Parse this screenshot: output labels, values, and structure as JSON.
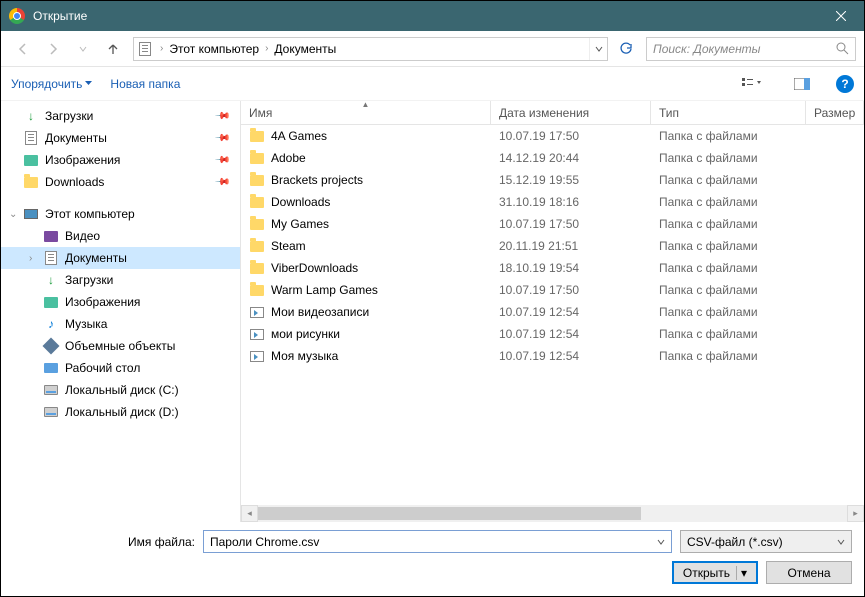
{
  "title": "Открытие",
  "breadcrumb": {
    "seg1": "Этот компьютер",
    "seg2": "Документы"
  },
  "search_placeholder": "Поиск: Документы",
  "toolbar": {
    "organize": "Упорядочить",
    "new_folder": "Новая папка"
  },
  "columns": {
    "name": "Имя",
    "date": "Дата изменения",
    "type": "Тип",
    "size": "Размер"
  },
  "sidebar_quick": [
    {
      "label": "Загрузки",
      "icon": "dl",
      "pinned": true
    },
    {
      "label": "Документы",
      "icon": "doc",
      "pinned": true
    },
    {
      "label": "Изображения",
      "icon": "pic",
      "pinned": true
    },
    {
      "label": "Downloads",
      "icon": "folder",
      "pinned": true
    }
  ],
  "sidebar_pc_label": "Этот компьютер",
  "sidebar_pc": [
    {
      "label": "Видео",
      "icon": "video"
    },
    {
      "label": "Документы",
      "icon": "doc",
      "selected": true
    },
    {
      "label": "Загрузки",
      "icon": "dl"
    },
    {
      "label": "Изображения",
      "icon": "pic"
    },
    {
      "label": "Музыка",
      "icon": "music"
    },
    {
      "label": "Объемные объекты",
      "icon": "3d"
    },
    {
      "label": "Рабочий стол",
      "icon": "desk"
    },
    {
      "label": "Локальный диск (C:)",
      "icon": "disk"
    },
    {
      "label": "Локальный диск (D:)",
      "icon": "disk"
    }
  ],
  "files": [
    {
      "name": "4A Games",
      "date": "10.07.19 17:50",
      "type": "Папка с файлами",
      "icon": "folder"
    },
    {
      "name": "Adobe",
      "date": "14.12.19 20:44",
      "type": "Папка с файлами",
      "icon": "folder"
    },
    {
      "name": "Brackets projects",
      "date": "15.12.19 19:55",
      "type": "Папка с файлами",
      "icon": "folder"
    },
    {
      "name": "Downloads",
      "date": "31.10.19 18:16",
      "type": "Папка с файлами",
      "icon": "folder"
    },
    {
      "name": "My Games",
      "date": "10.07.19 17:50",
      "type": "Папка с файлами",
      "icon": "folder"
    },
    {
      "name": "Steam",
      "date": "20.11.19 21:51",
      "type": "Папка с файлами",
      "icon": "folder"
    },
    {
      "name": "ViberDownloads",
      "date": "18.10.19 19:54",
      "type": "Папка с файлами",
      "icon": "folder"
    },
    {
      "name": "Warm Lamp Games",
      "date": "10.07.19 17:50",
      "type": "Папка с файлами",
      "icon": "folder"
    },
    {
      "name": "Мои видеозаписи",
      "date": "10.07.19 12:54",
      "type": "Папка с файлами",
      "icon": "media"
    },
    {
      "name": "мои рисунки",
      "date": "10.07.19 12:54",
      "type": "Папка с файлами",
      "icon": "media"
    },
    {
      "name": "Моя музыка",
      "date": "10.07.19 12:54",
      "type": "Папка с файлами",
      "icon": "media"
    }
  ],
  "filename_label": "Имя файла:",
  "filename_value": "Пароли Chrome.csv",
  "filetype_value": "CSV-файл (*.csv)",
  "btn_open": "Открыть",
  "btn_cancel": "Отмена"
}
